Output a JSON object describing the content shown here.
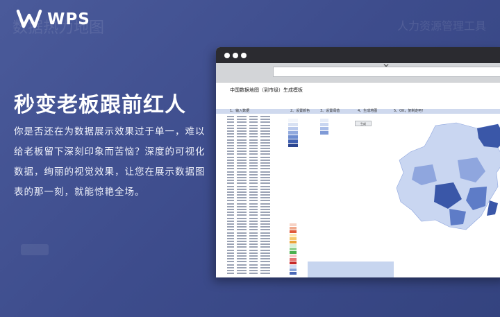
{
  "brand": {
    "name": "WPS",
    "logo_icon": "wps-logo-icon"
  },
  "ghost": {
    "left_text": "数据热力地图",
    "right_text": "人力资源管理工具"
  },
  "hero": {
    "headline": "秒变老板跟前红人",
    "description": "你是否还在为数据展示效果过于单一，难以给老板留下深刻印象而苦恼？深度的可视化数据，绚丽的视觉效果，让您在展示数据图表的那一刻，就能惊艳全场。"
  },
  "browser": {
    "tab_close": "✕",
    "document": {
      "title": "中国数据地图（到市级）生成模板",
      "steps": [
        "1、输入数据",
        "2、设置颜色",
        "3、设置阈值",
        "4、生成地图",
        "5、OK，复制走吧！"
      ],
      "button_label": "生成"
    }
  },
  "colors": {
    "bg_start": "#4a5a9a",
    "bg_end": "#34437f",
    "map_light": "#c9d6f1",
    "map_mid": "#8fa6de",
    "map_dark": "#3a57a8",
    "heat_red": "#e05a3a",
    "heat_green": "#4caf50"
  }
}
